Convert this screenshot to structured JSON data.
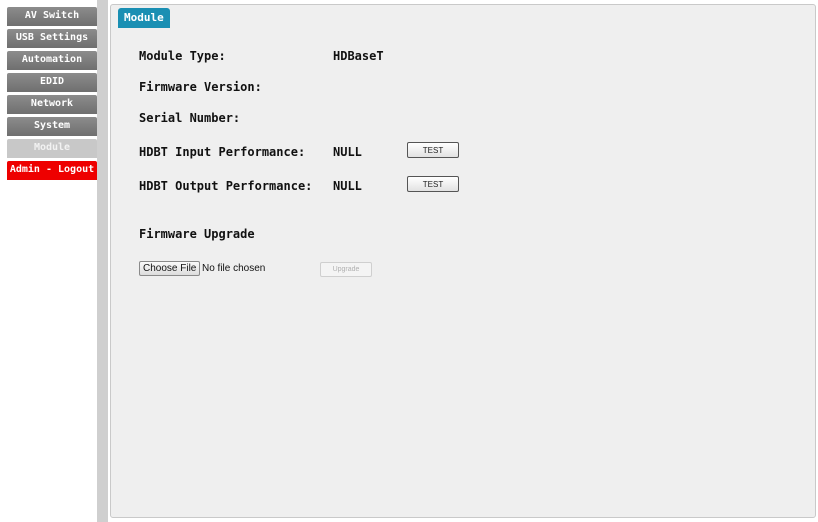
{
  "sidebar": {
    "items": [
      {
        "label": "AV Switch"
      },
      {
        "label": "USB Settings"
      },
      {
        "label": "Automation"
      },
      {
        "label": "EDID"
      },
      {
        "label": "Network"
      },
      {
        "label": "System"
      },
      {
        "label": "Module",
        "active": true
      },
      {
        "label": "Admin - Logout"
      }
    ]
  },
  "panel": {
    "title": "Module",
    "module_type_label": "Module Type:",
    "module_type_value": "HDBaseT",
    "firmware_version_label": "Firmware Version:",
    "serial_number_label": "Serial Number:",
    "hdbt_input_label": "HDBT Input Performance:",
    "hdbt_input_value": "NULL",
    "hdbt_input_test_label": "TEST",
    "hdbt_output_label": "HDBT Output Performance:",
    "hdbt_output_value": "NULL",
    "hdbt_output_test_label": "TEST",
    "firmware_upgrade_label": "Firmware Upgrade",
    "choose_file_label": "Choose File",
    "file_status": "No file chosen",
    "upgrade_label": "Upgrade"
  },
  "colors": {
    "tab_accent": "#1a8fb3",
    "nav_gray": "#7a7a7a",
    "nav_active": "#c8c8c8",
    "logout_red": "#ee0000",
    "panel_bg": "#efefef"
  }
}
